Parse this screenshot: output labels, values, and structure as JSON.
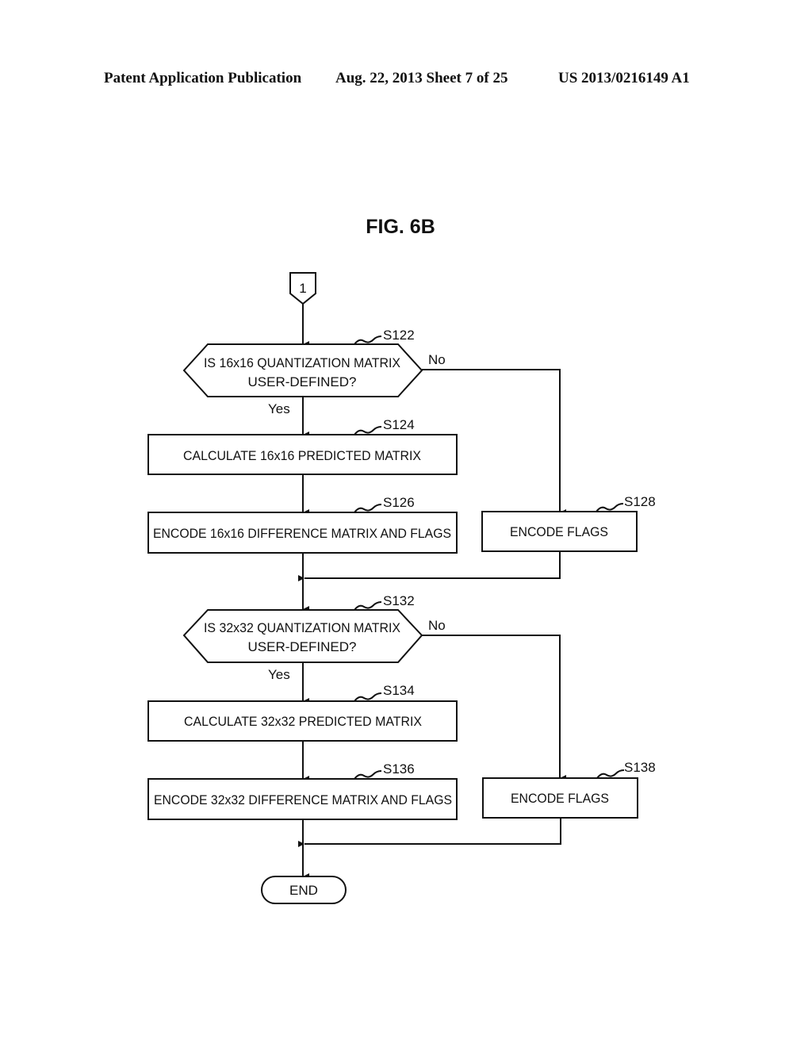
{
  "header": {
    "left": "Patent Application Publication",
    "middle": "Aug. 22, 2013  Sheet 7 of 25",
    "right": "US 2013/0216149 A1"
  },
  "figure": {
    "title": "FIG. 6B",
    "connector_label": "1",
    "decision1": {
      "step": "S122",
      "line1": "IS 16x16 QUANTIZATION MATRIX",
      "line2": "USER-DEFINED?",
      "yes": "Yes",
      "no": "No"
    },
    "step_s124": {
      "step": "S124",
      "text": "CALCULATE 16x16 PREDICTED MATRIX"
    },
    "step_s126": {
      "step": "S126",
      "text": "ENCODE 16x16 DIFFERENCE MATRIX AND FLAGS"
    },
    "step_s128": {
      "step": "S128",
      "text": "ENCODE FLAGS"
    },
    "decision2": {
      "step": "S132",
      "line1": "IS 32x32 QUANTIZATION MATRIX",
      "line2": "USER-DEFINED?",
      "yes": "Yes",
      "no": "No"
    },
    "step_s134": {
      "step": "S134",
      "text": "CALCULATE 32x32 PREDICTED MATRIX"
    },
    "step_s136": {
      "step": "S136",
      "text": "ENCODE 32x32 DIFFERENCE MATRIX AND FLAGS"
    },
    "step_s138": {
      "step": "S138",
      "text": "ENCODE FLAGS"
    },
    "end_label": "END"
  }
}
